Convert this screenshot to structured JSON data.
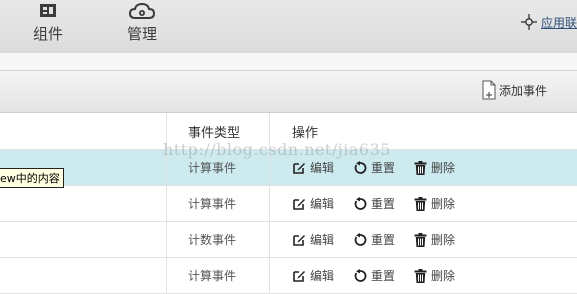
{
  "nav": {
    "items": [
      {
        "label": "组件",
        "icon": "grid-icon"
      },
      {
        "label": "管理",
        "icon": "cloud-gear-icon"
      }
    ],
    "link": {
      "label": "应用联",
      "icon": "network-icon"
    }
  },
  "toolbar": {
    "add_label": "添加事件",
    "icon": "add-file-icon"
  },
  "table": {
    "headers": {
      "type": "事件类型",
      "actions": "操作"
    },
    "action_labels": {
      "edit": "编辑",
      "reset": "重置",
      "delete": "删除"
    },
    "rows": [
      {
        "type": "计算事件",
        "highlighted": true
      },
      {
        "type": "计算事件",
        "highlighted": false
      },
      {
        "type": "计数事件",
        "highlighted": false
      },
      {
        "type": "计算事件",
        "highlighted": false
      }
    ]
  },
  "tooltip": "ew中的内容",
  "watermark": "http://blog.csdn.net/jia635",
  "colors": {
    "highlight_row": "#cdebef",
    "nav_bg": "#e3e3e3",
    "link": "#2f4f7a"
  }
}
